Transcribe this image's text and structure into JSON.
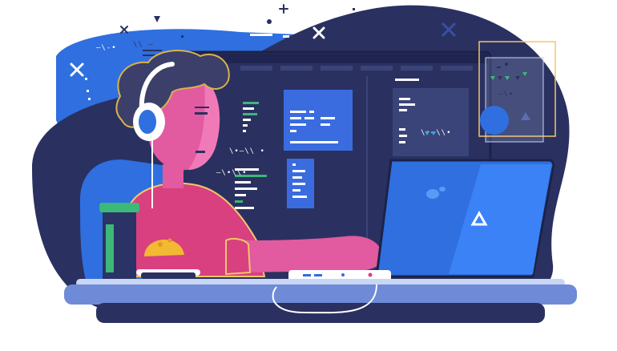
{
  "illustration": {
    "subject": "developer-at-desk",
    "colors": {
      "navy": "#2a3160",
      "deep_navy": "#20264f",
      "blue": "#2f6fe0",
      "light_blue": "#3b82f6",
      "monitor_blue": "#3a6ce0",
      "skin": "#e25aa0",
      "skin_light": "#f07ab8",
      "shirt": "#d8407f",
      "shirt_edge": "#f2c66a",
      "hair": "#3b3f6a",
      "hair_outline": "#d9b24c",
      "cup_green": "#3cb878",
      "cup_dark": "#2b3266",
      "desk": "#6f8ad6",
      "desk_top": "#c9d6f3",
      "taco": "#f2b933"
    },
    "floating_labels": [
      "—\\-•",
      "\\\\ —",
      "\\•—\\\\ •",
      "—\\•\\\\•",
      "\\•—\\\\•",
      "—\\—•",
      "—\\•"
    ],
    "icons": [
      "x-mark-icon",
      "triangle-icon",
      "plus-icon",
      "circle-icon"
    ]
  }
}
